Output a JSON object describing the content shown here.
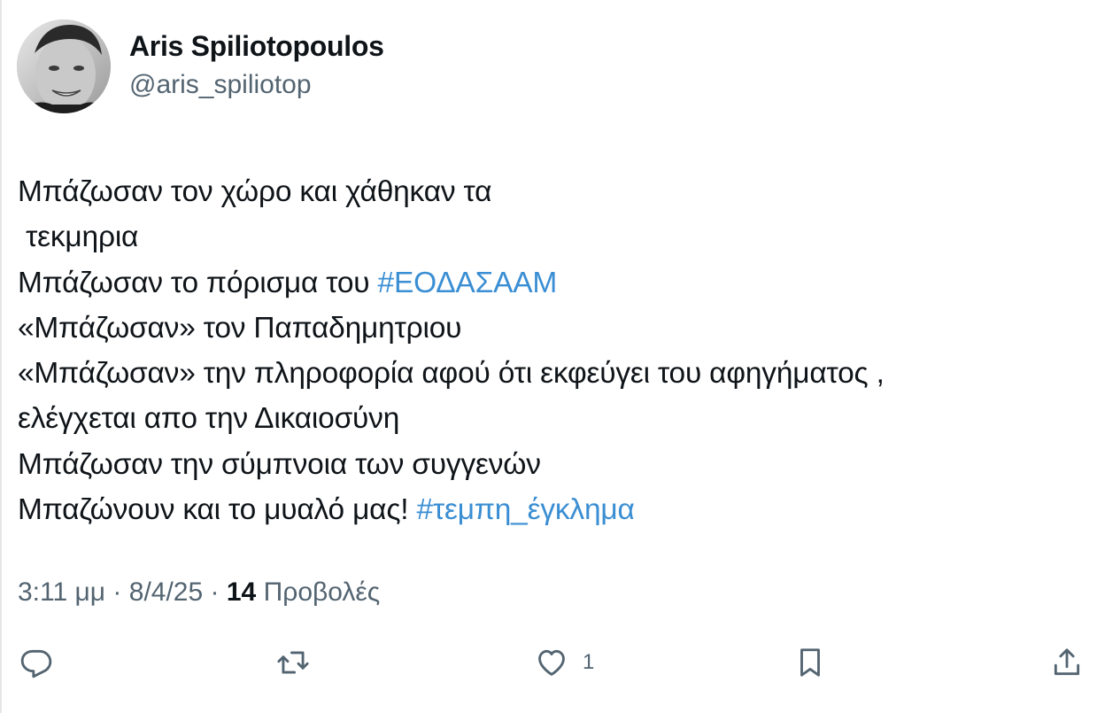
{
  "author": {
    "name": "Aris Spiliotopoulos",
    "handle": "@aris_spiliotop"
  },
  "tweet": {
    "lines": [
      [
        {
          "text": "Μπάζωσαν τον χώρο και χάθηκαν τα",
          "link": false
        }
      ],
      [
        {
          "text": " τεκμηρια",
          "link": false
        }
      ],
      [
        {
          "text": "Μπάζωσαν το πόρισμα του ",
          "link": false
        },
        {
          "text": "#ΕΟΔΑΣΑΑΜ",
          "link": true
        }
      ],
      [
        {
          "text": "«Μπάζωσαν» τον Παπαδημητριου",
          "link": false
        }
      ],
      [
        {
          "text": "«Μπάζωσαν» την πληροφορία αφού ότι εκφεύγει του αφηγήματος ,",
          "link": false
        }
      ],
      [
        {
          "text": "ελέγχεται απο την Δικαιοσύνη",
          "link": false
        }
      ],
      [
        {
          "text": "Μπάζωσαν την σύμπνοια των συγγενών",
          "link": false
        }
      ],
      [
        {
          "text": "Μπαζώνουν και το μυαλό μας! ",
          "link": false
        },
        {
          "text": "#τεμπη_έγκλημα",
          "link": true
        }
      ]
    ]
  },
  "meta": {
    "time": "3:11 μμ",
    "separator": "·",
    "date": "8/4/25",
    "views_count": "14",
    "views_label": "Προβολές"
  },
  "actions": {
    "reply_icon": "reply-icon",
    "retweet_icon": "retweet-icon",
    "like_icon": "like-icon",
    "like_count": "1",
    "bookmark_icon": "bookmark-icon",
    "share_icon": "share-icon"
  },
  "colors": {
    "text": "#0f1419",
    "secondary": "#536471",
    "hashtag": "#3a8ed3"
  }
}
